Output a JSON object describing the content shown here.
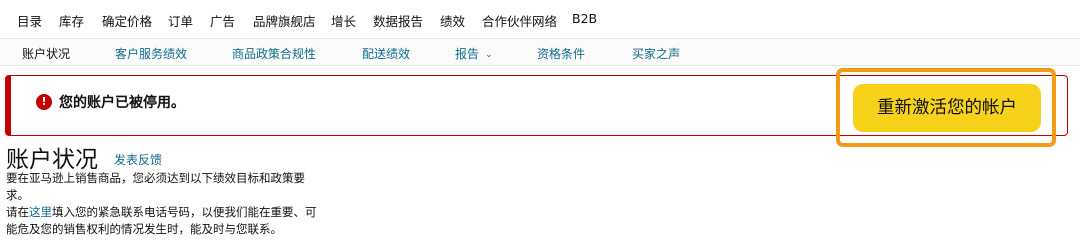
{
  "top_nav": {
    "items": [
      "目录",
      "库存",
      "确定价格",
      "订单",
      "广告",
      "品牌旗舰店",
      "增长",
      "数据报告",
      "绩效",
      "合作伙伴网络",
      "B2B"
    ]
  },
  "sub_nav": {
    "items": [
      "账户状况",
      "客户服务绩效",
      "商品政策合规性",
      "配送绩效",
      "报告",
      "资格条件",
      "买家之声"
    ],
    "active": "账户状况"
  },
  "alert": {
    "icon": "exclamation-circle-icon",
    "message": "您的账户已被停用。",
    "color": "#c40000"
  },
  "reactivate_button": {
    "label": "重新激活您的帐户",
    "color": "#f7d21b",
    "highlight_color": "#f59a15"
  },
  "page": {
    "title": "账户状况",
    "feedback_link": "发表反馈",
    "paragraph1_line1": "要在亚马逊上销售商品，您必须达到以下绩效目标和政策要",
    "paragraph1_line2": "求。",
    "paragraph2_prefix": "请在",
    "paragraph2_link": "这里",
    "paragraph2_rest": "填入您的紧急联系电话号码，以便我们能在重要、可",
    "paragraph2_line2": "能危及您的销售权利的情况发生时，能及时与您联系。"
  }
}
